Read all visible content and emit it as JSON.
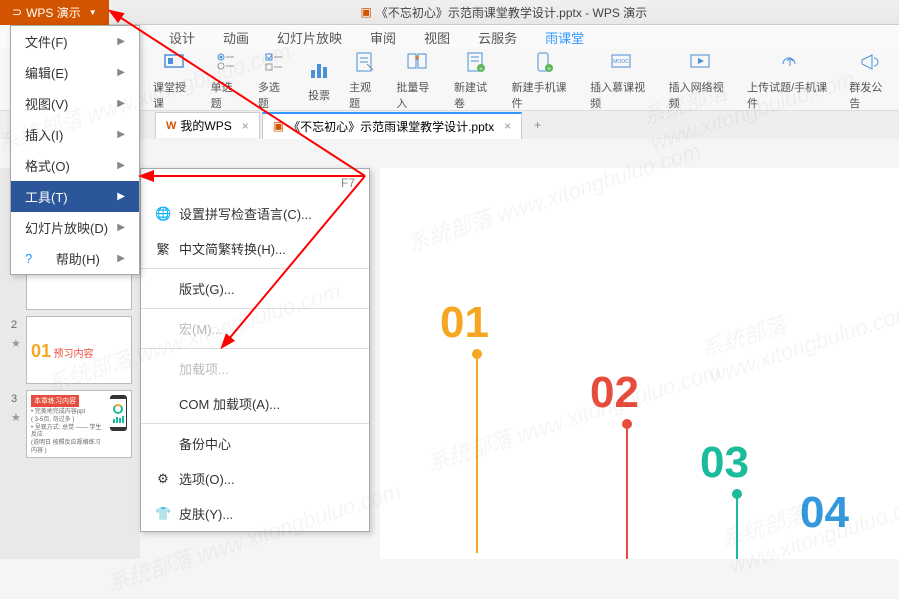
{
  "title": {
    "brand": "WPS 演示",
    "doc": "《不忘初心》示范雨课堂教学设计.pptx - WPS 演示"
  },
  "menu": {
    "items": [
      "设计",
      "动画",
      "幻灯片放映",
      "审阅",
      "视图",
      "云服务",
      "雨课堂"
    ],
    "active_index": 6
  },
  "ribbon": {
    "items": [
      {
        "label": "课堂授课"
      },
      {
        "label": "单选题"
      },
      {
        "label": "多选题"
      },
      {
        "label": "投票"
      },
      {
        "label": "主观题"
      },
      {
        "label": "批量导入"
      },
      {
        "label": "新建试卷"
      },
      {
        "label": "新建手机课件"
      },
      {
        "label": "插入慕课视频"
      },
      {
        "label": "插入网络视频"
      },
      {
        "label": "上传试题/手机课件"
      },
      {
        "label": "群发公告"
      }
    ]
  },
  "tabs": {
    "items": [
      {
        "label": "我的WPS",
        "icon": "wps"
      },
      {
        "label": "《不忘初心》示范雨课堂教学设计.pptx",
        "icon": "p",
        "active": true
      }
    ]
  },
  "dropdown": {
    "items": [
      {
        "label": "文件(F)",
        "arrow": true
      },
      {
        "label": "编辑(E)",
        "arrow": true
      },
      {
        "label": "视图(V)",
        "arrow": true
      },
      {
        "label": "插入(I)",
        "arrow": true
      },
      {
        "label": "格式(O)",
        "arrow": true
      },
      {
        "label": "工具(T)",
        "arrow": true,
        "highlight": true
      },
      {
        "label": "幻灯片放映(D)",
        "arrow": true
      },
      {
        "label": "帮助(H)",
        "arrow": true,
        "help": true
      }
    ]
  },
  "submenu": {
    "first_shortcut": "F7",
    "items": [
      {
        "label": "设置拼写检查语言(C)...",
        "icon": "🌐"
      },
      {
        "label": "中文简繁转换(H)...",
        "icon": "繁"
      },
      {
        "sep": true
      },
      {
        "label": "版式(G)..."
      },
      {
        "sep": true
      },
      {
        "label": "宏(M)...",
        "disabled": true
      },
      {
        "sep": true
      },
      {
        "label": "加载项...",
        "disabled": true
      },
      {
        "label": "COM 加载项(A)..."
      },
      {
        "sep": true
      },
      {
        "label": "备份中心"
      },
      {
        "label": "选项(O)...",
        "icon": "⚙"
      },
      {
        "label": "皮肤(Y)...",
        "icon": "👕"
      }
    ]
  },
  "slides": {
    "s1_nums": [
      "01",
      "02",
      "03",
      "04"
    ],
    "s2_num": "01",
    "s2_txt": "预习内容",
    "s3_hdr": "本章练习内容",
    "s3_l1": "• 完美地完成内容ppt",
    "s3_l2": "( 3-5页, 勿过多 )",
    "s3_l3": "• 呈现方式: 总觉 —— 学生反应",
    "s3_l4": "(说明日 按照反应规格练习内容 )",
    "indexes": [
      "",
      "2",
      "3"
    ]
  },
  "canvas": {
    "n1": "01",
    "n2": "02",
    "n3": "03",
    "n4": "04"
  },
  "watermark": "系统部落 www.xitongbuluo.com"
}
